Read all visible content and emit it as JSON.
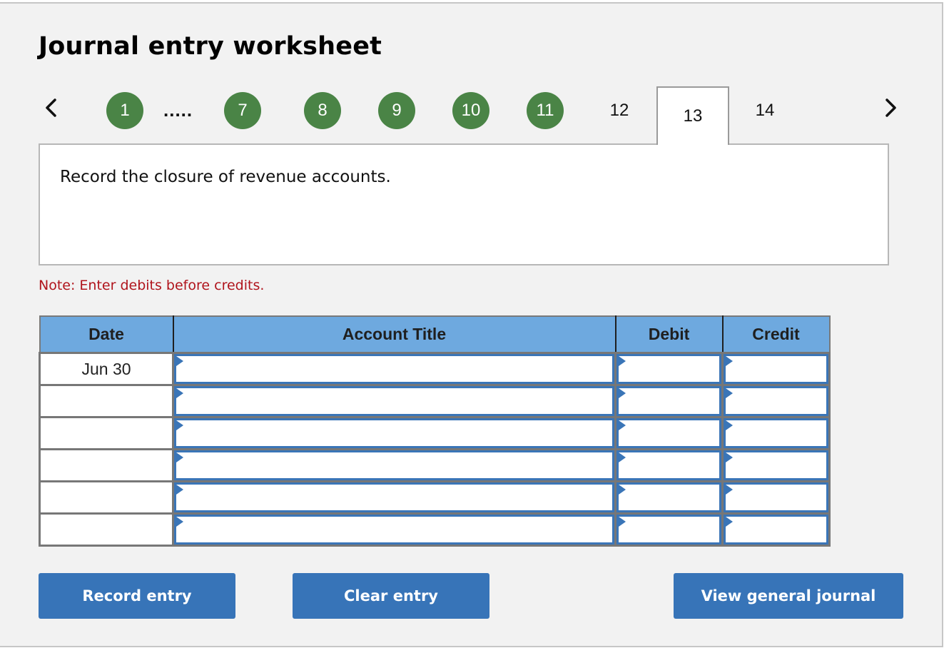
{
  "title": "Journal entry worksheet",
  "navigation": {
    "prev_icon": "chevron-left-icon",
    "next_icon": "chevron-right-icon",
    "ellipsis": ".....",
    "steps": [
      {
        "label": "1",
        "status": "completed"
      },
      {
        "label": "7",
        "status": "completed"
      },
      {
        "label": "8",
        "status": "completed"
      },
      {
        "label": "9",
        "status": "completed"
      },
      {
        "label": "10",
        "status": "completed"
      },
      {
        "label": "11",
        "status": "completed"
      },
      {
        "label": "12",
        "status": "pending"
      },
      {
        "label": "13",
        "status": "active"
      },
      {
        "label": "14",
        "status": "pending"
      }
    ]
  },
  "instruction": "Record the closure of revenue accounts.",
  "note": "Note: Enter debits before credits.",
  "table": {
    "headers": {
      "date": "Date",
      "account": "Account Title",
      "debit": "Debit",
      "credit": "Credit"
    },
    "rows": [
      {
        "date": "Jun 30",
        "account": "",
        "debit": "",
        "credit": ""
      },
      {
        "date": "",
        "account": "",
        "debit": "",
        "credit": ""
      },
      {
        "date": "",
        "account": "",
        "debit": "",
        "credit": ""
      },
      {
        "date": "",
        "account": "",
        "debit": "",
        "credit": ""
      },
      {
        "date": "",
        "account": "",
        "debit": "",
        "credit": ""
      },
      {
        "date": "",
        "account": "",
        "debit": "",
        "credit": ""
      }
    ]
  },
  "buttons": {
    "record": "Record entry",
    "clear": "Clear entry",
    "view_journal": "View general journal"
  },
  "colors": {
    "completed_step": "#4a8446",
    "header_bg": "#6ea9df",
    "input_border": "#3a75b7",
    "button_bg": "#3774b8",
    "note_text": "#b0141c"
  }
}
